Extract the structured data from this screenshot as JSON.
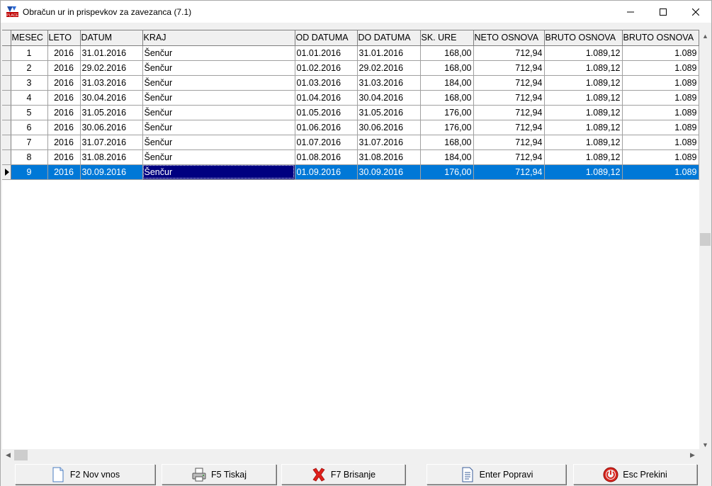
{
  "window": {
    "title": "Obračun ur in prispevkov za zavezanca  (7.1)"
  },
  "grid": {
    "columns": [
      "MESEC",
      "LETO",
      "DATUM",
      "KRAJ",
      "OD DATUMA",
      "DO DATUMA",
      "SK. URE",
      "NETO OSNOVA",
      "BRUTO OSNOVA",
      "BRUTO OSNOVA"
    ],
    "rows": [
      [
        "1",
        "2016",
        "31.01.2016",
        "Šenčur",
        "01.01.2016",
        "31.01.2016",
        "168,00",
        "712,94",
        "1.089,12",
        "1.089"
      ],
      [
        "2",
        "2016",
        "29.02.2016",
        "Šenčur",
        "01.02.2016",
        "29.02.2016",
        "168,00",
        "712,94",
        "1.089,12",
        "1.089"
      ],
      [
        "3",
        "2016",
        "31.03.2016",
        "Šenčur",
        "01.03.2016",
        "31.03.2016",
        "184,00",
        "712,94",
        "1.089,12",
        "1.089"
      ],
      [
        "4",
        "2016",
        "30.04.2016",
        "Šenčur",
        "01.04.2016",
        "30.04.2016",
        "168,00",
        "712,94",
        "1.089,12",
        "1.089"
      ],
      [
        "5",
        "2016",
        "31.05.2016",
        "Šenčur",
        "01.05.2016",
        "31.05.2016",
        "176,00",
        "712,94",
        "1.089,12",
        "1.089"
      ],
      [
        "6",
        "2016",
        "30.06.2016",
        "Šenčur",
        "01.06.2016",
        "30.06.2016",
        "176,00",
        "712,94",
        "1.089,12",
        "1.089"
      ],
      [
        "7",
        "2016",
        "31.07.2016",
        "Šenčur",
        "01.07.2016",
        "31.07.2016",
        "168,00",
        "712,94",
        "1.089,12",
        "1.089"
      ],
      [
        "8",
        "2016",
        "31.08.2016",
        "Šenčur",
        "01.08.2016",
        "31.08.2016",
        "184,00",
        "712,94",
        "1.089,12",
        "1.089"
      ],
      [
        "9",
        "2016",
        "30.09.2016",
        "Šenčur",
        "01.09.2016",
        "30.09.2016",
        "176,00",
        "712,94",
        "1.089,12",
        "1.089"
      ]
    ],
    "selected_row_index": 8,
    "focused_column_index": 3,
    "selection_color": "#0078d7",
    "focus_color": "#000080"
  },
  "toolbar": {
    "buttons": [
      {
        "label": "F2 Nov vnos",
        "icon": "document-icon"
      },
      {
        "label": "F5 Tiskaj",
        "icon": "printer-icon"
      },
      {
        "label": "F7 Brisanje",
        "icon": "delete-x-icon"
      },
      {
        "label": "Enter Popravi",
        "icon": "edit-document-icon"
      },
      {
        "label": "Esc Prekini",
        "icon": "power-icon"
      }
    ]
  }
}
